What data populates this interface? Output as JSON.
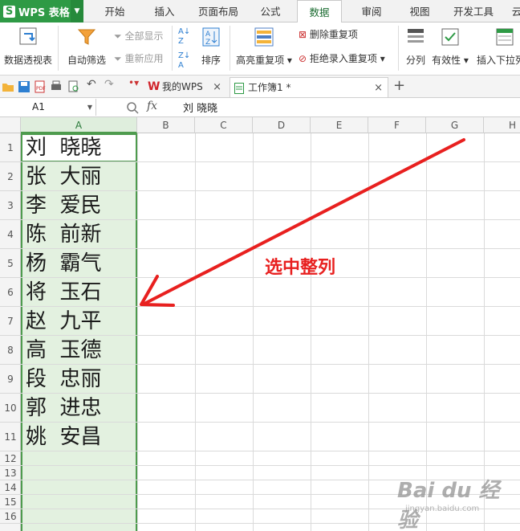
{
  "app": {
    "title": "WPS 表格"
  },
  "ribbon_tabs": [
    {
      "label": "开始"
    },
    {
      "label": "插入"
    },
    {
      "label": "页面布局"
    },
    {
      "label": "公式"
    },
    {
      "label": "数据"
    },
    {
      "label": "审阅"
    },
    {
      "label": "视图"
    },
    {
      "label": "开发工具"
    },
    {
      "label": "云"
    }
  ],
  "ribbon": {
    "pivot": "数据透视表",
    "autofilter": "自动筛选",
    "show_all": "全部显示",
    "reapply": "重新应用",
    "sort": "排序",
    "highlight_dup": "高亮重复项",
    "remove_dup": "删除重复项",
    "reject_dup": "拒绝录入重复项",
    "split": "分列",
    "validity": "有效性",
    "insert_dropdown": "插入下拉列"
  },
  "doc_tabs": [
    {
      "label": "我的WPS"
    },
    {
      "label": "工作簿1 *"
    }
  ],
  "formula_bar": {
    "cell_ref": "A1",
    "fx": "fx",
    "value": "刘  晓晓"
  },
  "columns": [
    "A",
    "B",
    "C",
    "D",
    "E",
    "F",
    "G",
    "H"
  ],
  "rows": [
    "1",
    "2",
    "3",
    "4",
    "5",
    "6",
    "7",
    "8",
    "9",
    "10",
    "11",
    "12",
    "13",
    "14",
    "15",
    "16"
  ],
  "column_a": [
    "刘  晓晓",
    "张  大丽",
    "李  爱民",
    "陈  前新",
    "杨  霸气",
    "将  玉石",
    "赵  九平",
    "高  玉德",
    "段  忠丽",
    "郭  进忠",
    "姚  安昌"
  ],
  "annotation": "选中整列",
  "watermark": {
    "brand": "Bai du 经验",
    "url": "jingyan.baidu.com"
  },
  "colors": {
    "accent": "#2e9a45",
    "selection": "#4e9b4e",
    "annotation": "#e8201f"
  }
}
